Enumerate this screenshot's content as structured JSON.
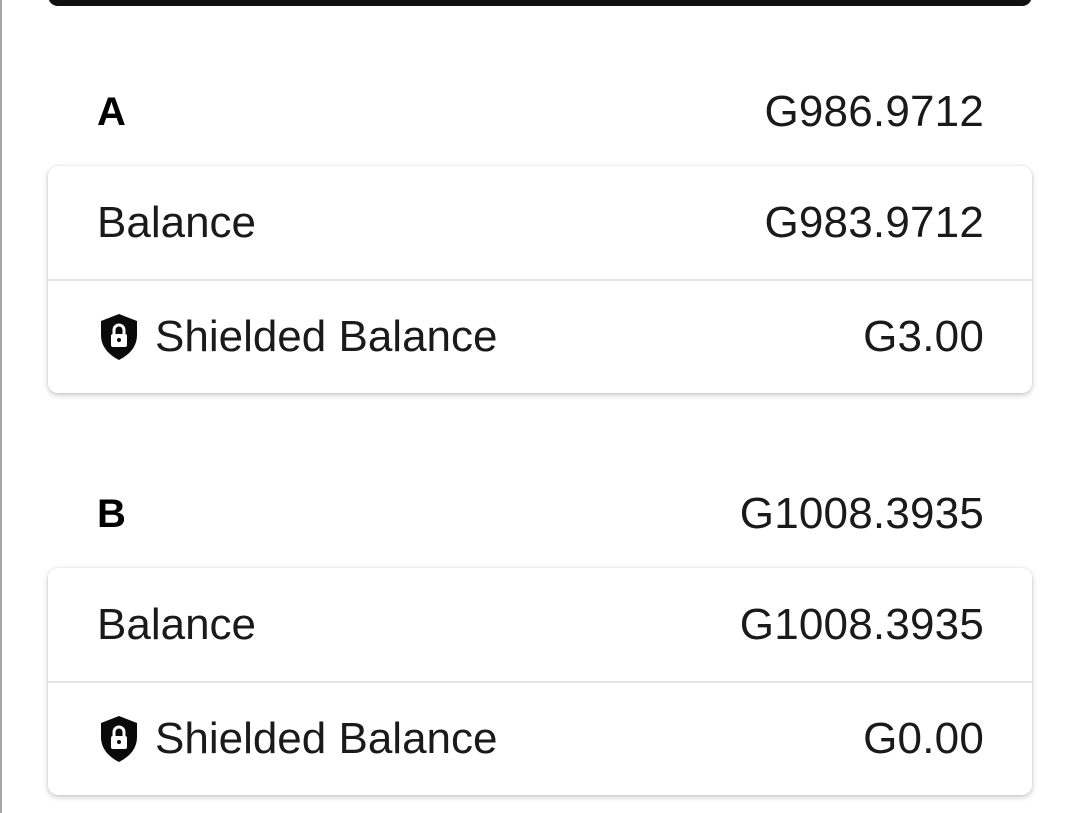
{
  "accounts": [
    {
      "name": "A",
      "total": "G986.9712",
      "balance_label": "Balance",
      "balance_value": "G983.9712",
      "shielded_label": "Shielded Balance",
      "shielded_value": "G3.00",
      "shielded_icon": "shield-lock-icon"
    },
    {
      "name": "B",
      "total": "G1008.3935",
      "balance_label": "Balance",
      "balance_value": "G1008.3935",
      "shielded_label": "Shielded Balance",
      "shielded_value": "G0.00",
      "shielded_icon": "shield-lock-icon"
    }
  ],
  "colors": {
    "text": "#1a1a1a",
    "divider": "#e4e4e4",
    "background": "#ffffff"
  }
}
